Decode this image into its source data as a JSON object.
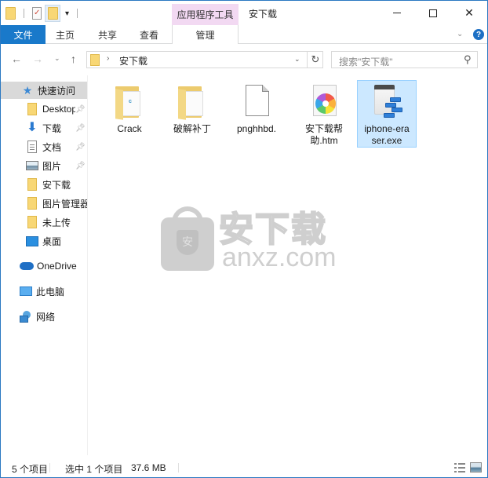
{
  "window": {
    "title": "安下载",
    "contextual_tab_group": "应用程序工具",
    "controls": {
      "minimize": "minimize",
      "maximize": "maximize",
      "close": "close"
    }
  },
  "quick_access_toolbar": {
    "icons": [
      "folder-icon",
      "properties-icon",
      "new-folder-icon",
      "customize-dropdown-icon"
    ]
  },
  "ribbon": {
    "tabs": [
      {
        "label": "文件",
        "active": true
      },
      {
        "label": "主页"
      },
      {
        "label": "共享"
      },
      {
        "label": "查看"
      },
      {
        "label": "管理"
      }
    ],
    "help_label": "?"
  },
  "nav": {
    "back": "←",
    "forward": "→",
    "recent": "⌄",
    "up": "↑",
    "address": {
      "separator": "›",
      "crumbs": [
        "安下载"
      ],
      "refresh": "↻"
    },
    "search": {
      "placeholder": "搜索\"安下载\""
    }
  },
  "navpane": {
    "items": [
      {
        "label": "快速访问",
        "icon": "star-icon",
        "selected": true
      },
      {
        "label": "Desktop",
        "icon": "folder-icon",
        "pinned": true
      },
      {
        "label": "下载",
        "icon": "download-icon",
        "pinned": true
      },
      {
        "label": "文档",
        "icon": "document-icon",
        "pinned": true
      },
      {
        "label": "图片",
        "icon": "pictures-icon",
        "pinned": true
      },
      {
        "label": "安下载",
        "icon": "folder-icon"
      },
      {
        "label": "图片管理器",
        "icon": "folder-icon"
      },
      {
        "label": "未上传",
        "icon": "folder-icon"
      },
      {
        "label": "桌面",
        "icon": "desktop-icon"
      },
      {
        "label": "OneDrive",
        "icon": "onedrive-icon"
      },
      {
        "label": "此电脑",
        "icon": "this-pc-icon"
      },
      {
        "label": "网络",
        "icon": "network-icon"
      }
    ]
  },
  "files": [
    {
      "name": "Crack",
      "type": "folder",
      "icon": "folder-icon"
    },
    {
      "name": "破解补丁",
      "type": "folder",
      "icon": "folder-icon"
    },
    {
      "name": "pnghhbd.",
      "type": "file",
      "icon": "blank-file-icon"
    },
    {
      "name": "安下载帮助.htm",
      "type": "htm",
      "icon": "html-file-icon"
    },
    {
      "name": "iphone-eraser.exe",
      "type": "exe",
      "icon": "application-icon",
      "selected": true
    }
  ],
  "watermark": {
    "cn": "安下载",
    "en": "anxz.com",
    "shield": "安"
  },
  "statusbar": {
    "item_count": "5 个项目",
    "selected": "选中 1 个项目",
    "selected_size": "37.6 MB"
  }
}
